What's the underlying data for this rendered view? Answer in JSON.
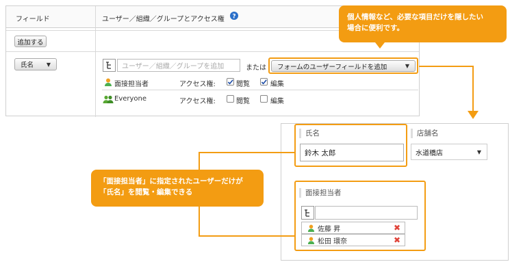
{
  "panel": {
    "col_field": "フィールド",
    "col_access": "ユーザー／組織／グループとアクセス権",
    "help_icon": "question-circle-icon",
    "add_button": "追加する",
    "field_select": "氏名",
    "user_input_placeholder": "ユーザー／組織／グループを追加",
    "or_label": "または",
    "add_form_field_button": "フォームのユーザーフィールドを追加",
    "rows": [
      {
        "name": "面接担当者",
        "access_label": "アクセス権:",
        "view_label": "閲覧",
        "view_checked": true,
        "edit_label": "編集",
        "edit_checked": true
      },
      {
        "name": "Everyone",
        "access_label": "アクセス権:",
        "view_label": "閲覧",
        "view_checked": false,
        "edit_label": "編集",
        "edit_checked": false
      }
    ]
  },
  "callout_top": {
    "line1": "個人情報など、必要な項目だけを隠したい",
    "line2": "場合に便利です。"
  },
  "callout_left": {
    "line1": "「面接担当者」に指定されたユーザーだけが",
    "line2": "「氏名」を閲覧・編集できる"
  },
  "preview": {
    "name_label": "氏名",
    "name_value": "鈴木 太郎",
    "store_label": "店舗名",
    "store_value": "水道橋店",
    "interviewer_label": "面接担当者",
    "users": [
      "佐藤 昇",
      "松田 環奈"
    ]
  },
  "colors": {
    "accent": "#f39c12",
    "delete": "#e0443a",
    "user_icon": "#f0a020",
    "group_icon": "#58a832"
  }
}
